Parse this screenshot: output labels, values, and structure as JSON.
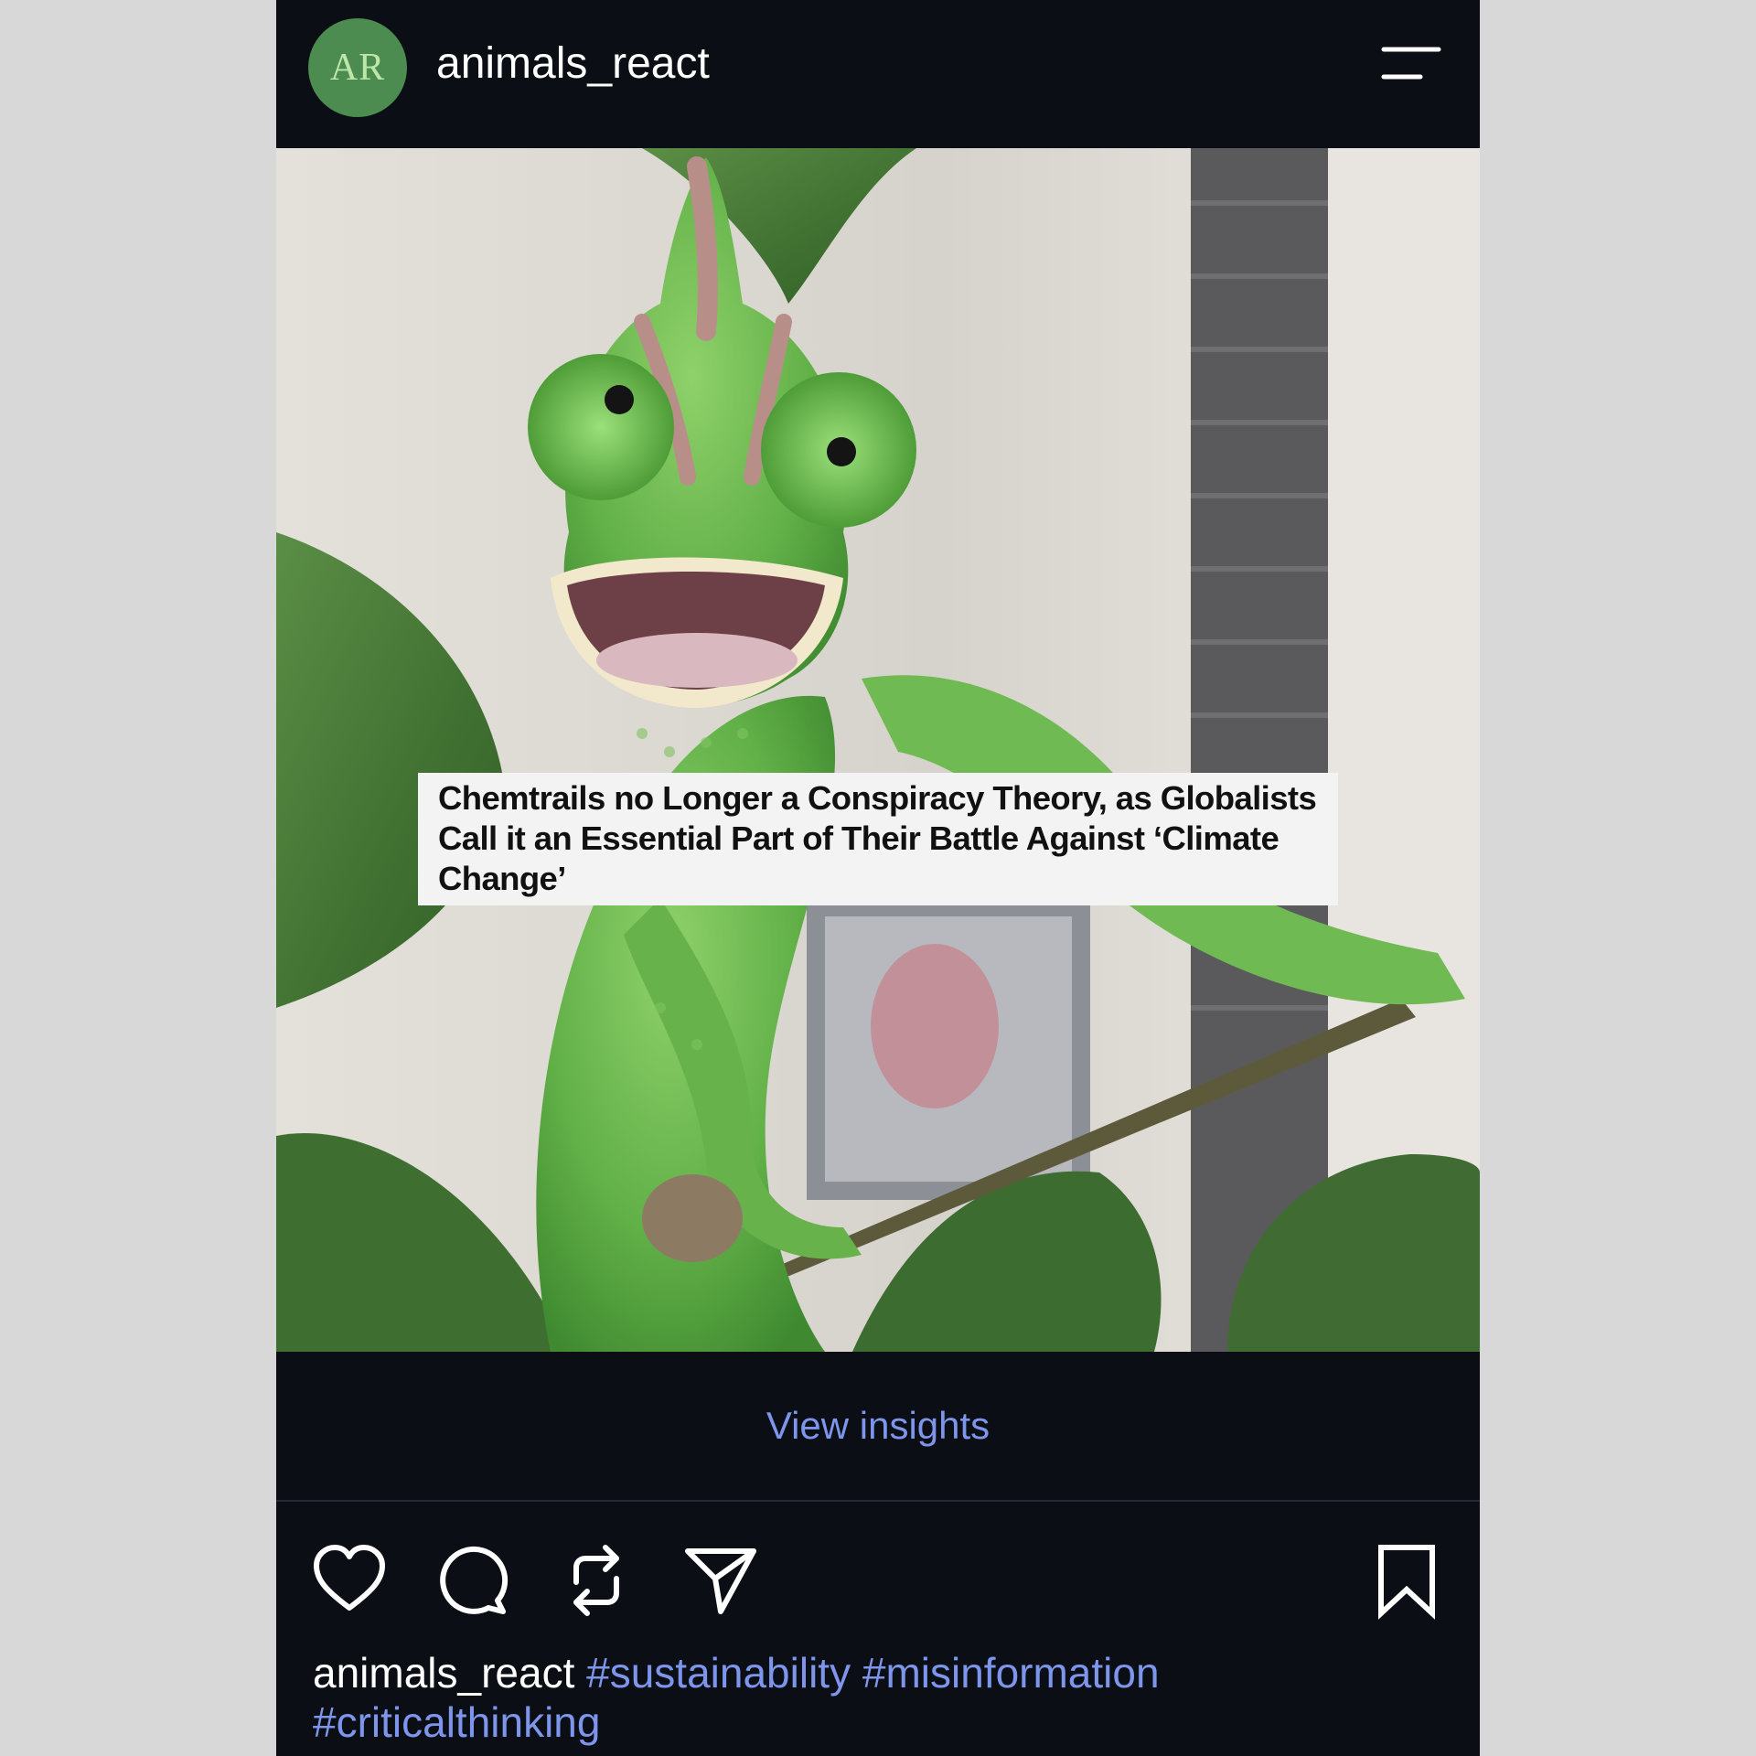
{
  "post": {
    "avatar_initials": "AR",
    "username": "animals_react",
    "headline": "Chemtrails no Longer a Conspiracy Theory, as Globalists Call it an Essential Part of Their Battle Against ‘Climate Change’",
    "insights_label": "View insights",
    "caption": {
      "username": "animals_react",
      "hashtags": [
        "#sustainability",
        "#misinformation",
        "#criticalthinking"
      ]
    },
    "icons": {
      "menu": "menu-icon",
      "like": "heart-icon",
      "comment": "comment-icon",
      "repost": "repost-icon",
      "share": "send-icon",
      "save": "bookmark-icon"
    }
  },
  "colors": {
    "background": "#0b0e14",
    "avatar": "#4c8c50",
    "link": "#7e95ec"
  }
}
